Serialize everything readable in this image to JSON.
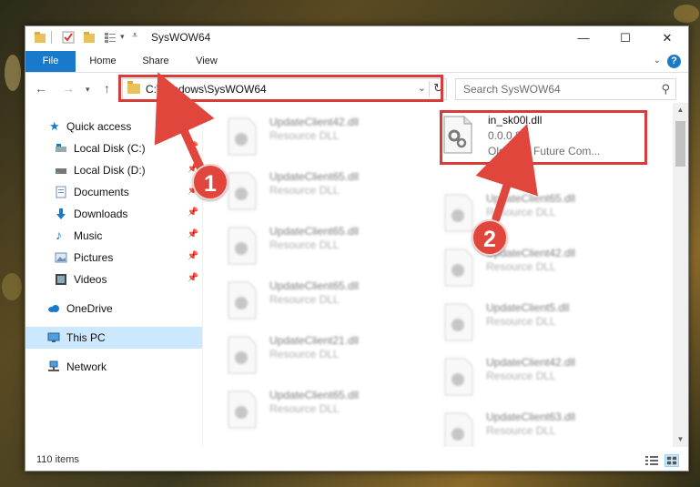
{
  "window": {
    "title": "SysWOW64",
    "controls": {
      "minimize": "—",
      "maximize": "☐",
      "close": "✕"
    }
  },
  "ribbon": {
    "tabs": [
      "File",
      "Home",
      "Share",
      "View"
    ],
    "help": "?"
  },
  "navigation": {
    "address_path": "C:\\Windows\\SysWOW64",
    "search_placeholder": "Search SysWOW64"
  },
  "sidebar": {
    "items": [
      {
        "label": "Quick access",
        "icon": "star-icon",
        "pinned": false
      },
      {
        "label": "Local Disk (C:)",
        "icon": "drive-icon",
        "pinned": true
      },
      {
        "label": "Local Disk (D:)",
        "icon": "drive-icon",
        "pinned": true
      },
      {
        "label": "Documents",
        "icon": "documents-icon",
        "pinned": true
      },
      {
        "label": "Downloads",
        "icon": "download-icon",
        "pinned": true
      },
      {
        "label": "Music",
        "icon": "music-icon",
        "pinned": true
      },
      {
        "label": "Pictures",
        "icon": "pictures-icon",
        "pinned": true
      },
      {
        "label": "Videos",
        "icon": "videos-icon",
        "pinned": true
      },
      {
        "label": "OneDrive",
        "icon": "cloud-icon",
        "pinned": false
      },
      {
        "label": "This PC",
        "icon": "computer-icon",
        "pinned": false,
        "selected": true
      },
      {
        "label": "Network",
        "icon": "network-icon",
        "pinned": false
      }
    ]
  },
  "files": {
    "highlighted": {
      "name": "in_sk00l.dll",
      "version": "0.0.0.84",
      "description": "Oldsk00l Future Com..."
    },
    "left_column": [
      {
        "name": "UpdateClient42.dll",
        "type": "Resource DLL"
      },
      {
        "name": "UpdateClient65.dll",
        "type": "Resource DLL"
      },
      {
        "name": "UpdateClient65.dll",
        "type": "Resource DLL"
      },
      {
        "name": "UpdateClient65.dll",
        "type": "Resource DLL"
      },
      {
        "name": "UpdateClient21.dll",
        "type": "Resource DLL"
      },
      {
        "name": "UpdateClient65.dll",
        "type": "Resource DLL"
      }
    ],
    "right_column": [
      {
        "name": "UpdateClient65.dll",
        "type": "Resource DLL"
      },
      {
        "name": "UpdateClient42.dll",
        "type": "Resource DLL"
      },
      {
        "name": "UpdateClient5.dll",
        "type": "Resource DLL"
      },
      {
        "name": "UpdateClient42.dll",
        "type": "Resource DLL"
      },
      {
        "name": "UpdateClient63.dll",
        "type": "Resource DLL"
      }
    ]
  },
  "status": {
    "item_count": "110 items"
  },
  "annotations": {
    "step1": "1",
    "step2": "2",
    "color": "#e0463c",
    "box_color": "#d93a3a"
  }
}
